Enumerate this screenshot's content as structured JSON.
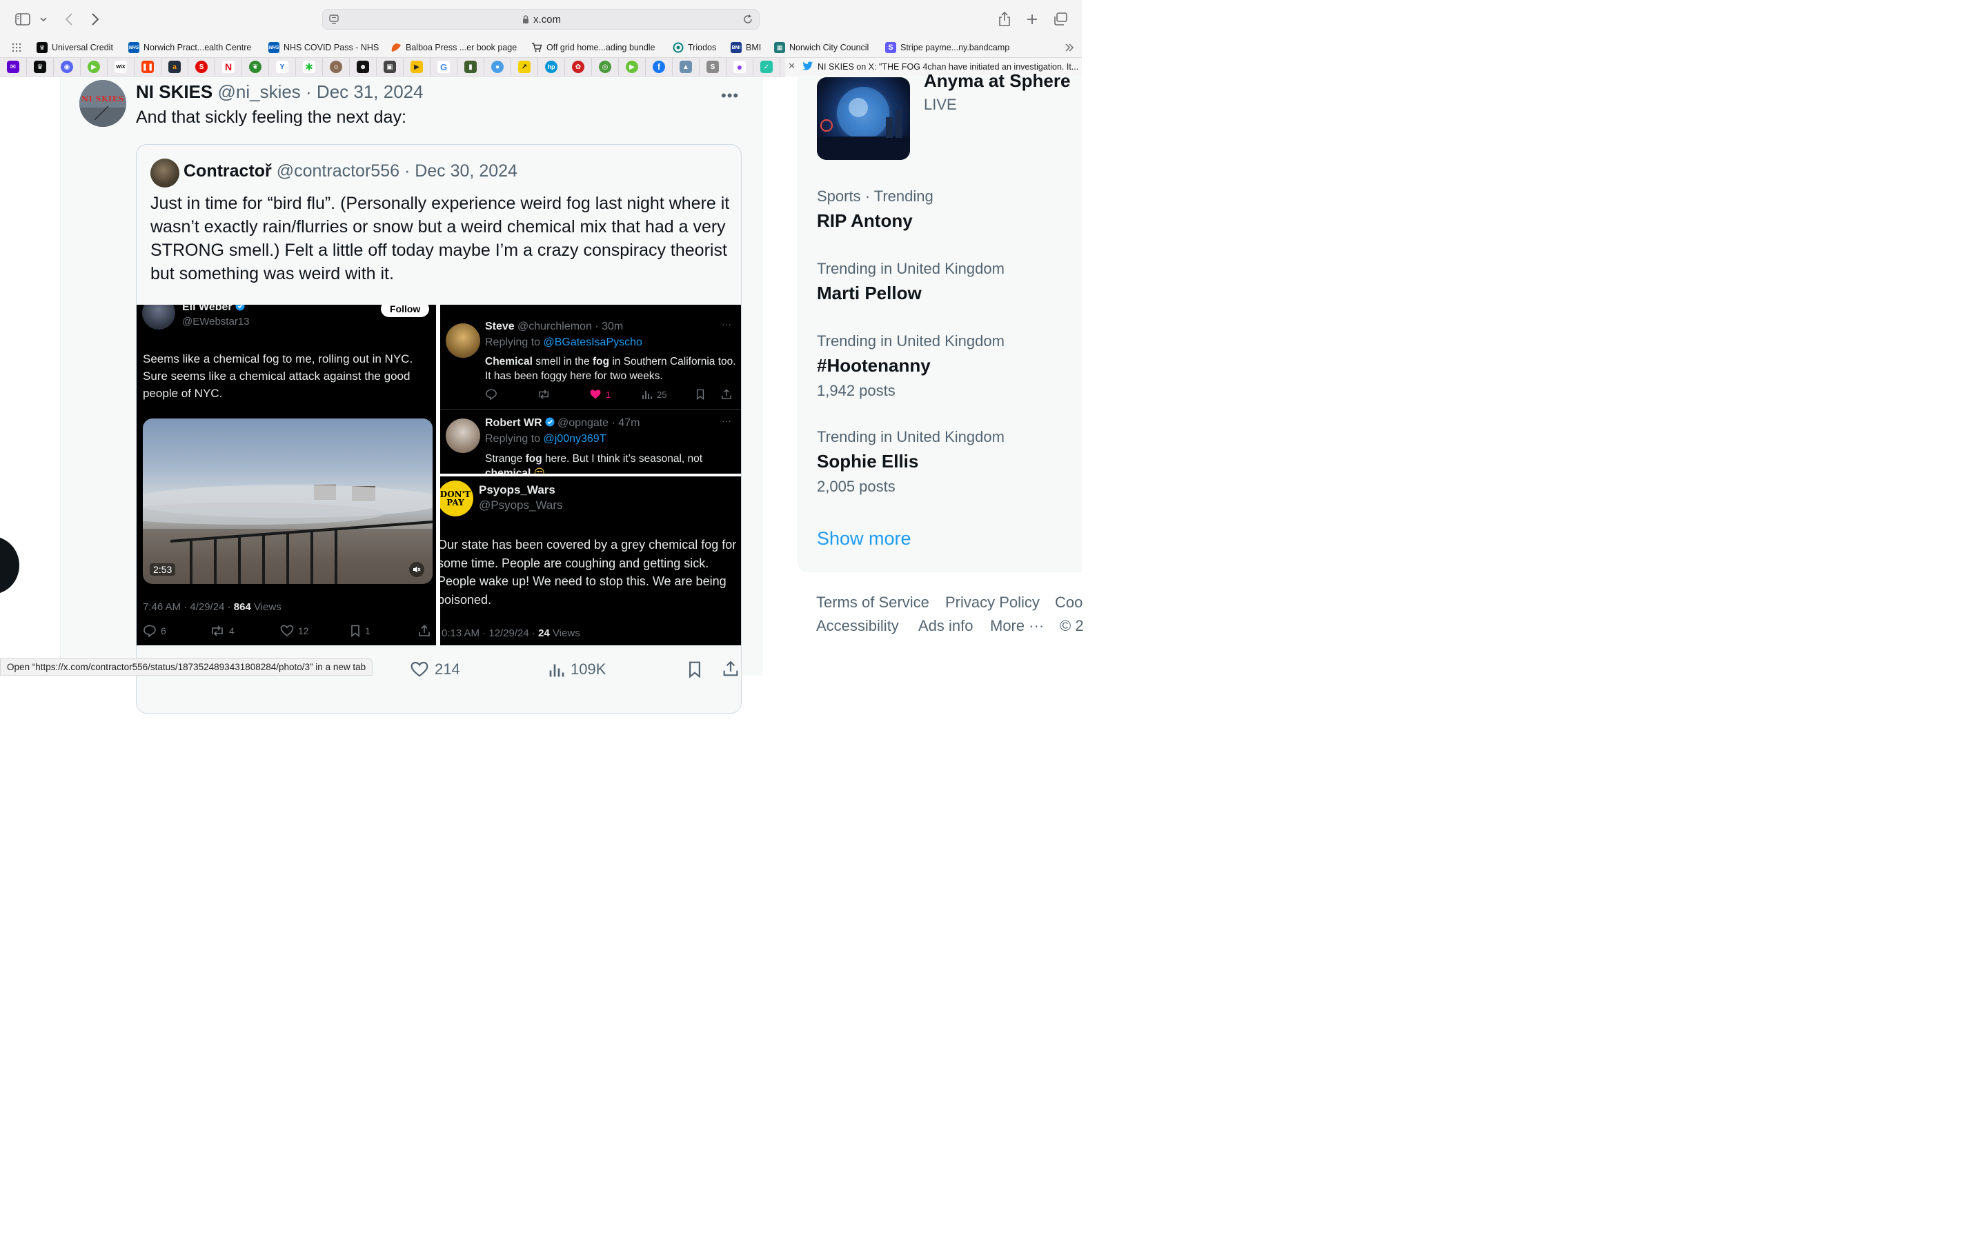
{
  "browser": {
    "url": "x.com",
    "bookmarks": [
      {
        "label": "Universal Credit",
        "icon": "crown-icon",
        "color": "#000000"
      },
      {
        "label": "Norwich Pract...ealth Centre",
        "icon": "nhs-icon",
        "color": "#005eb8"
      },
      {
        "label": "NHS COVID Pass - NHS",
        "icon": "nhs-icon",
        "color": "#005eb8"
      },
      {
        "label": "Balboa Press ...er book page",
        "icon": "leaf-icon",
        "color": "#e8601c"
      },
      {
        "label": "Off grid home...ading bundle",
        "icon": "cart-icon",
        "color": "#333333"
      },
      {
        "label": "Triodos",
        "icon": "triodos-icon",
        "color": "#00817f"
      },
      {
        "label": "BMI",
        "icon": "bmi-icon",
        "color": "#1b3c8c"
      },
      {
        "label": "Norwich City Council",
        "icon": "council-icon",
        "color": "#1f7a78"
      },
      {
        "label": "Stripe payme...ny.bandcamp",
        "icon": "stripe-icon",
        "color": "#635bff"
      }
    ],
    "active_tab_title": "NI SKIES on X: \"THE FOG 4chan have initiated an investigation. It..."
  },
  "post": {
    "author_name": "NI SKIES",
    "author_meta": "@ni_skies · Dec 31, 2024",
    "avatar_text": "NI SKIES",
    "text": "And that sickly feeling the next day:",
    "quote": {
      "author_name": "Contractoř",
      "author_meta": "@contractor556 · Dec 30, 2024",
      "text": "Just in time for “bird flu”. (Personally experience weird fog last night where it wasn’t exactly rain/flurries or snow but a weird chemical mix that had a very STRONG smell.) Felt a little off today maybe I’m a crazy conspiracy theorist but something was weird with it."
    },
    "media": {
      "eli": {
        "name": "Eli Weber",
        "handle": "@EWebstar13",
        "follow_label": "Follow",
        "body": "Seems like a chemical fog to me, rolling out in NYC. Sure seems like a chemical attack against the good people of NYC.",
        "video_duration": "2:53",
        "time": "7:46 AM · 4/29/24 · ",
        "views": "864",
        "views_label": " Views",
        "replies": "6",
        "reposts": "4",
        "likes": "12",
        "bookmarks": "1"
      },
      "steve": {
        "name": "Steve",
        "meta": "@churchlemon · 30m",
        "replying_prefix": "Replying to ",
        "replying_to": "@BGatesIsaPyscho",
        "body_bold1": "Chemical",
        "body_mid1": " smell in the ",
        "body_bold2": "fog",
        "body_rest": " in Southern California too. It has been foggy here for two weeks.",
        "likes": "1",
        "views": "25"
      },
      "robert": {
        "name": "Robert WR",
        "meta": "@opngate · 47m",
        "replying_prefix": "Replying to ",
        "replying_to": "@j00ny369T",
        "body_pre": "Strange ",
        "body_bold": "fog",
        "body_post": " here. But I think it’s seasonal, not",
        "body_cut": "chemical"
      },
      "psyops": {
        "name": "Psyops_Wars",
        "handle": "@Psyops_Wars",
        "avatar_text": "DON'T PAY",
        "body": "Our state has been covered by a grey chemical fog for some time.  People are coughing and getting sick.  People wake up! We need to stop this.  We are being poisoned.",
        "time": "0:13 AM · 12/29/24 · ",
        "views": "24",
        "views_label": " Views"
      }
    },
    "actions": {
      "likes": "214",
      "views": "109K"
    }
  },
  "sidebar": {
    "event": {
      "title": "Anyma at Sphere",
      "status": "LIVE"
    },
    "trends": [
      {
        "context": "Sports · Trending",
        "name": "RIP Antony",
        "posts": ""
      },
      {
        "context": "Trending in United Kingdom",
        "name": "Marti Pellow",
        "posts": ""
      },
      {
        "context": "Trending in United Kingdom",
        "name": "#Hootenanny",
        "posts": "1,942 posts"
      },
      {
        "context": "Trending in United Kingdom",
        "name": "Sophie Ellis",
        "posts": "2,005 posts"
      }
    ],
    "show_more": "Show more",
    "footer": {
      "terms": "Terms of Service",
      "privacy": "Privacy Policy",
      "cookie": "Coo",
      "accessibility": "Accessibility",
      "ads_info": "Ads info",
      "more": "More ···",
      "copyright": "© 2"
    }
  },
  "status_bar": "Open “https://x.com/contractor556/status/1873524893431808284/photo/3” in a new tab"
}
